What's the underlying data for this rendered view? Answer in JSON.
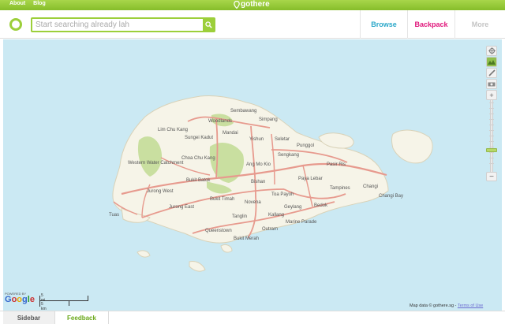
{
  "topbar": {
    "links": [
      "About",
      "Blog"
    ],
    "brand": "gothere"
  },
  "search": {
    "placeholder": "Start searching already lah",
    "value": ""
  },
  "nav": {
    "browse": "Browse",
    "backpack": "Backpack",
    "more": "More"
  },
  "map": {
    "places": [
      "Sembawang",
      "Woodlands",
      "Simpang",
      "Lim Chu Kang",
      "Mandai",
      "Sungei Kadut",
      "Yishun",
      "Seletar",
      "Punggol",
      "Choa Chu Kang",
      "Western Water Catchment",
      "Ang Mo Kio",
      "Sengkang",
      "Pasir Ris",
      "Bukit Batok",
      "Bishan",
      "Paya Lebar",
      "Tampines",
      "Changi",
      "Jurong West",
      "Bukit Timah",
      "Toa Payoh",
      "Changi Bay",
      "Jurong East",
      "Novena",
      "Geylang",
      "Bedok",
      "Tuas",
      "Tanglin",
      "Kallang",
      "Marine Parade",
      "Queenstown",
      "Outram",
      "Bukit Merah"
    ],
    "zoom_in": "+",
    "zoom_out": "−"
  },
  "footer": {
    "powered_by": "POWERED BY",
    "google": "Google",
    "scale_mi": "5 mi",
    "scale_km": "5 km",
    "attribution": "Map data © gothere.sg - ",
    "terms": "Terms of Use"
  },
  "tabs": {
    "sidebar": "Sidebar",
    "feedback": "Feedback"
  },
  "colors": {
    "brand_green": "#9ccf3a",
    "browse_blue": "#2aa7c9",
    "backpack_pink": "#e0177b",
    "water": "#cbe9f3",
    "land": "#f6f4e8",
    "park": "#c9dfa0",
    "road": "#e79a8e"
  }
}
